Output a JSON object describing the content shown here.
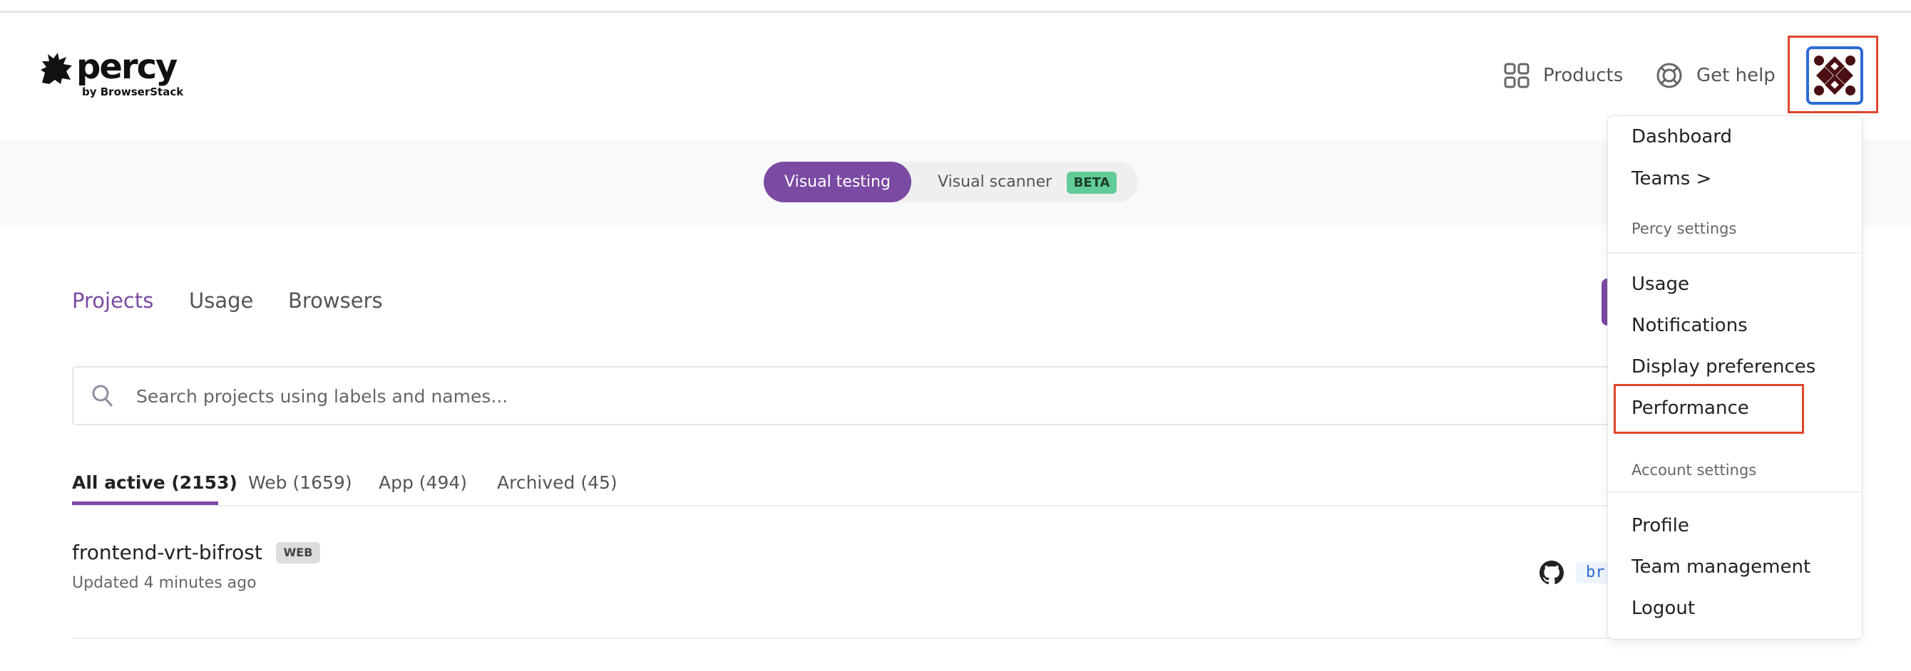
{
  "header": {
    "logo": {
      "word": "percy",
      "sub": "by BrowserStack"
    },
    "products_label": "Products",
    "help_label": "Get help",
    "icons": {
      "products": "grid-icon",
      "help": "lifebuoy-icon",
      "avatar": "user-avatar"
    }
  },
  "mode_toggle": {
    "visual_testing": "Visual testing",
    "visual_scanner": "Visual scanner",
    "beta_badge": "BETA"
  },
  "nav_tabs": [
    {
      "label": "Projects",
      "active": true
    },
    {
      "label": "Usage"
    },
    {
      "label": "Browsers"
    }
  ],
  "search": {
    "placeholder": "Search projects using labels and names...",
    "value": ""
  },
  "filter_tabs": [
    {
      "label": "All active (2153)",
      "active": true
    },
    {
      "label": "Web (1659)"
    },
    {
      "label": "App (494)"
    },
    {
      "label": "Archived (45)"
    }
  ],
  "projects": [
    {
      "name": "frontend-vrt-bifrost",
      "tag": "WEB",
      "updated": "Updated 4 minutes ago",
      "branch_partial": "br"
    }
  ],
  "user_menu": {
    "items_top": [
      "Dashboard",
      "Teams >"
    ],
    "percy_settings_header": "Percy settings",
    "percy_items": [
      "Usage",
      "Notifications",
      "Display preferences",
      "Performance"
    ],
    "account_settings_header": "Account settings",
    "account_items": [
      "Profile",
      "Team management",
      "Logout"
    ],
    "highlighted": "Performance"
  },
  "colors": {
    "accent": "#7b4aa3",
    "beta": "#62cc96",
    "highlight": "#e0452e",
    "avatar_border": "#2d6ad6"
  }
}
